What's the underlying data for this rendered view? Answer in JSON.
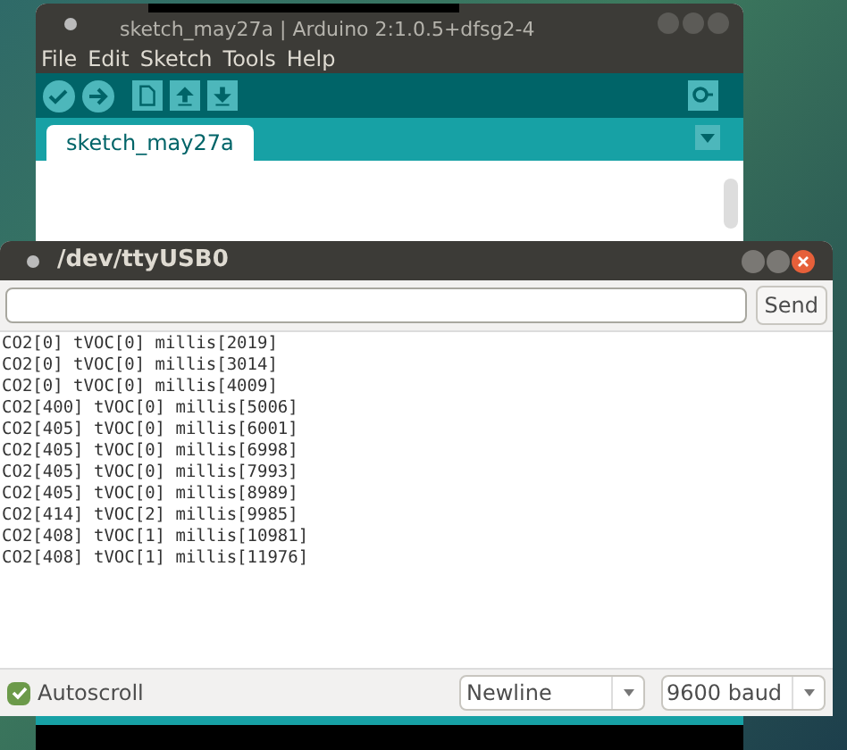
{
  "ide_window": {
    "title": "sketch_may27a | Arduino 2:1.0.5+dfsg2-4",
    "menu": [
      "File",
      "Edit",
      "Sketch",
      "Tools",
      "Help"
    ],
    "toolbar": [
      {
        "kind": "verify"
      },
      {
        "kind": "upload"
      },
      {
        "kind": "new"
      },
      {
        "kind": "open"
      },
      {
        "kind": "save"
      }
    ],
    "tabs": [
      {
        "label": "sketch_may27a",
        "selected": true
      }
    ]
  },
  "serial_monitor": {
    "title": "/dev/ttyUSB0",
    "send_button": "Send",
    "output": [
      "CO2[0] tVOC[0] millis[2019]",
      "CO2[0] tVOC[0] millis[3014]",
      "CO2[0] tVOC[0] millis[4009]",
      "CO2[400] tVOC[0] millis[5006]",
      "CO2[405] tVOC[0] millis[6001]",
      "CO2[405] tVOC[0] millis[6998]",
      "CO2[405] tVOC[0] millis[7993]",
      "CO2[405] tVOC[0] millis[8989]",
      "CO2[414] tVOC[2] millis[9985]",
      "CO2[408] tVOC[1] millis[10981]",
      "CO2[408] tVOC[1] millis[11976]"
    ],
    "autoscroll": {
      "label": "Autoscroll",
      "checked": true
    },
    "line_ending": "Newline",
    "baud_rate": "9600 baud"
  }
}
